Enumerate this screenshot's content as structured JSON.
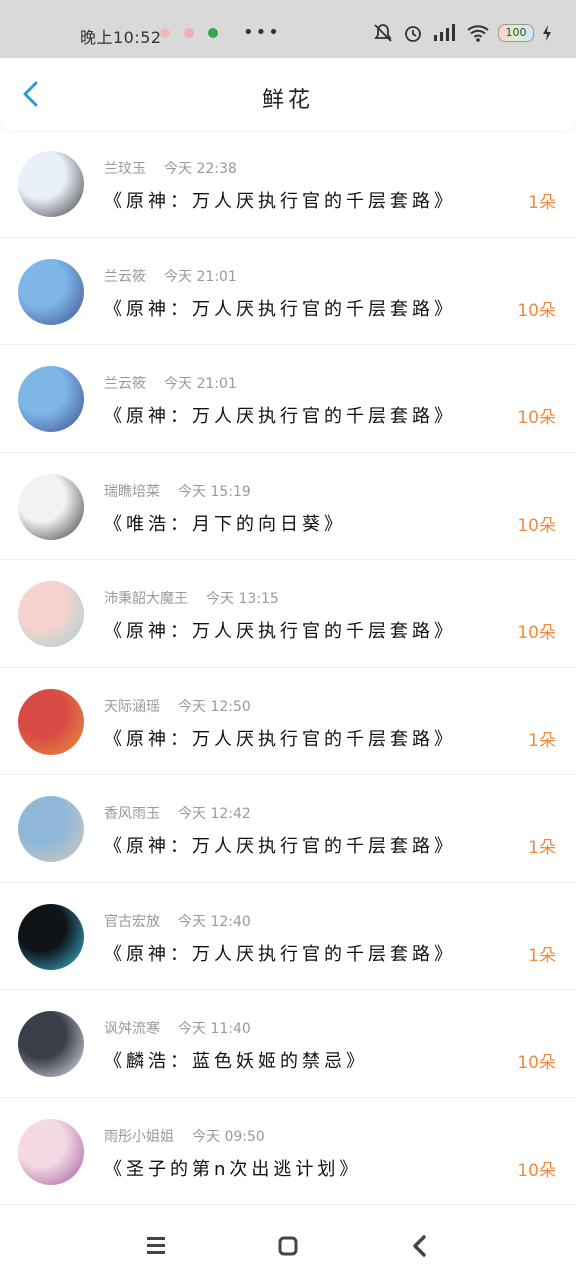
{
  "status_bar": {
    "time": "晚上10:52",
    "more": "•••",
    "battery": "100",
    "colors": {
      "dot1": "#f2b8b8",
      "dot2": "#e9b3b3",
      "dot3": "#2fa84f"
    }
  },
  "header": {
    "title": "鲜花",
    "back_icon": "chevron-left-icon",
    "accent": "#2f97e0"
  },
  "rows": [
    {
      "name": "兰玟玉",
      "time": "今天 22:38",
      "book": "《原神：万人厌执行官的千层套路》",
      "count": "1朵",
      "avatar_colors": [
        "#e9f0f7",
        "#39383d"
      ]
    },
    {
      "name": "兰云筱",
      "time": "今天 21:01",
      "book": "《原神：万人厌执行官的千层套路》",
      "count": "10朵",
      "avatar_colors": [
        "#7fb6e8",
        "#3a4f8f"
      ]
    },
    {
      "name": "兰云筱",
      "time": "今天 21:01",
      "book": "《原神：万人厌执行官的千层套路》",
      "count": "10朵",
      "avatar_colors": [
        "#7fb6e8",
        "#3a4f8f"
      ]
    },
    {
      "name": "瑞瞧培菜",
      "time": "今天 15:19",
      "book": "《唯浩：月下的向日葵》",
      "count": "10朵",
      "avatar_colors": [
        "#f2f2f0",
        "#3b3938"
      ]
    },
    {
      "name": "沛秉韶大魔王",
      "time": "今天 13:15",
      "book": "《原神：万人厌执行官的千层套路》",
      "count": "10朵",
      "avatar_colors": [
        "#f6d3cf",
        "#9fd3d0"
      ]
    },
    {
      "name": "天际涵瑶",
      "time": "今天 12:50",
      "book": "《原神：万人厌执行官的千层套路》",
      "count": "1朵",
      "avatar_colors": [
        "#d94a45",
        "#e3963c"
      ]
    },
    {
      "name": "香风雨玉",
      "time": "今天 12:42",
      "book": "《原神：万人厌执行官的千层套路》",
      "count": "1朵",
      "avatar_colors": [
        "#8fb7d8",
        "#d7cbb6"
      ]
    },
    {
      "name": "官古宏放",
      "time": "今天 12:40",
      "book": "《原神：万人厌执行官的千层套路》",
      "count": "1朵",
      "avatar_colors": [
        "#0f1418",
        "#3fbfe6"
      ]
    },
    {
      "name": "讽舛流寒",
      "time": "今天 11:40",
      "book": "《麟浩：蓝色妖姬的禁忌》",
      "count": "10朵",
      "avatar_colors": [
        "#3a3f4a",
        "#e8e8ee"
      ]
    },
    {
      "name": "雨彤小姐姐",
      "time": "今天 09:50",
      "book": "《圣子的第n次出逃计划》",
      "count": "10朵",
      "avatar_colors": [
        "#f4d9e5",
        "#a05a9a"
      ]
    }
  ],
  "nav": {
    "menu_icon": "menu-icon",
    "home_icon": "home-square-icon",
    "back_icon": "back-triangle-icon"
  }
}
